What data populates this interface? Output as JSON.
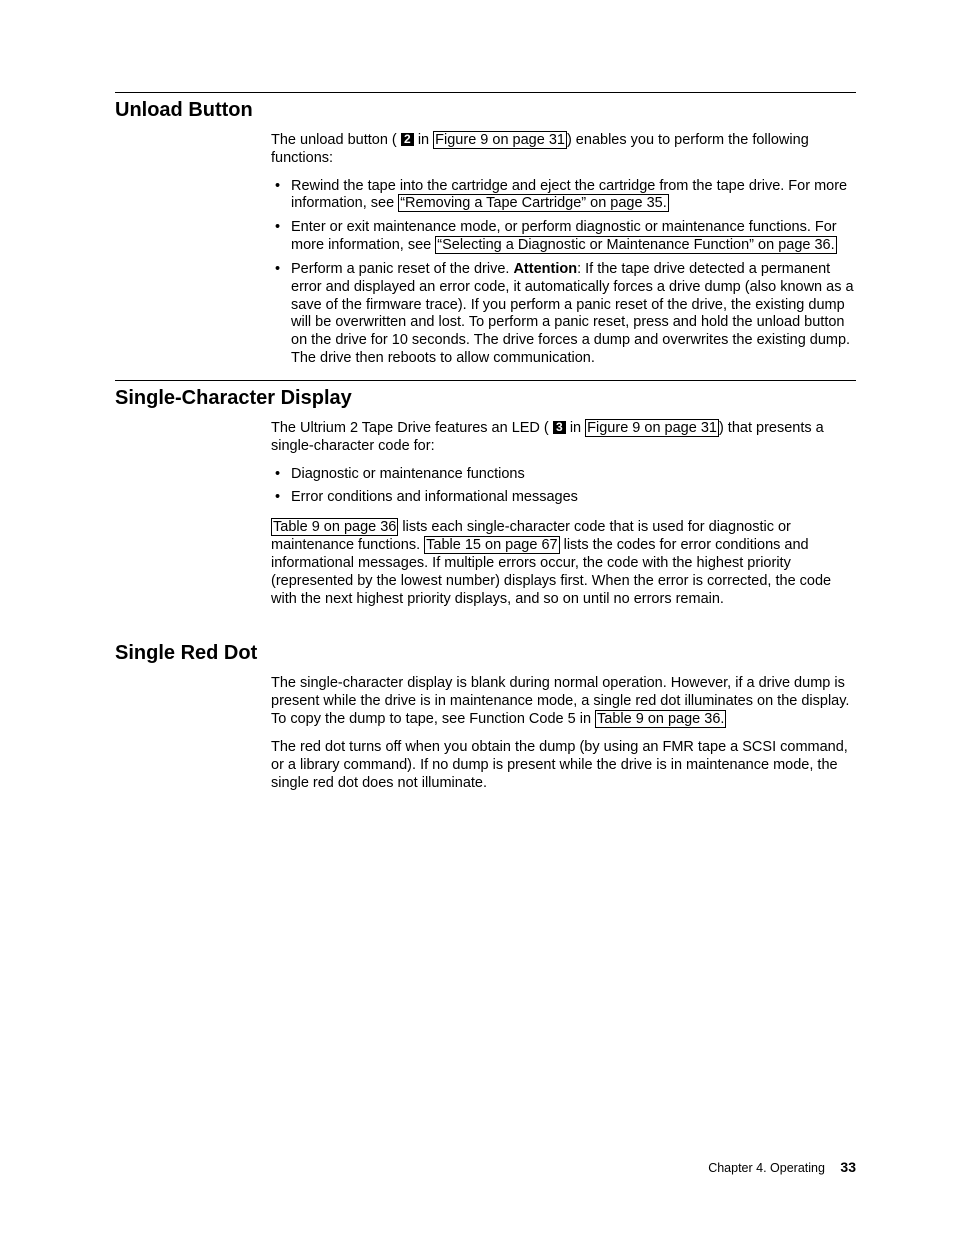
{
  "sections": {
    "unload": {
      "heading": "Unload Button",
      "intro_a": "The unload button (",
      "callout": "2",
      "intro_b": " in ",
      "fig_ref": "Figure 9 on page 31",
      "intro_c": ") enables you to perform the following functions:",
      "li1_a": "Rewind the tape into the cartridge and eject the cartridge from the tape drive. For more information, see ",
      "li1_ref": "“Removing a Tape Cartridge” on page 35.",
      "li2_a": "Enter or exit maintenance mode, or perform diagnostic or maintenance functions. For more information, see ",
      "li2_ref": "“Selecting a Diagnostic or Maintenance Function” on page 36.",
      "li3_a": "Perform a panic reset of the drive. ",
      "li3_attention": "Attention",
      "li3_b": ": If the tape drive detected a permanent error and displayed an error code, it automatically forces a drive dump (also known as a save of the firmware trace). If you perform a panic reset of the drive, the existing dump will be overwritten and lost. To perform a panic reset, press and hold the unload button on the drive for 10 seconds. The drive forces a dump and overwrites the existing dump. The drive then reboots to allow communication."
    },
    "scd": {
      "heading": "Single-Character Display",
      "intro_a": "The Ultrium 2 Tape Drive features an LED (",
      "callout": "3",
      "intro_b": " in ",
      "fig_ref": "Figure 9 on page 31",
      "intro_c": ") that presents a single-character code for:",
      "li1": "Diagnostic or maintenance functions",
      "li2": "Error conditions and informational messages",
      "p2_ref1": "Table 9 on page 36",
      "p2_a": " lists each single-character code that is used for diagnostic or maintenance functions. ",
      "p2_ref2": "Table 15 on page 67",
      "p2_b": " lists the codes for error conditions and informational messages. If multiple errors occur, the code with the highest priority (represented by the lowest number) displays first. When the error is corrected, the code with the next highest priority displays, and so on until no errors remain."
    },
    "red": {
      "heading": "Single Red Dot",
      "p1_a": "The single-character display is blank during normal operation. However, if a drive dump is present while the drive is in maintenance mode, a single red dot illuminates on the display. To copy the dump to tape, see Function Code 5 in ",
      "p1_ref": "Table 9 on page 36.",
      "p2": "The red dot turns off when you obtain the dump (by using an FMR tape a SCSI command, or a library command). If no dump is present while the drive is in maintenance mode, the single red dot does not illuminate."
    }
  },
  "footer": {
    "chapter": "Chapter 4. Operating",
    "page": "33"
  }
}
